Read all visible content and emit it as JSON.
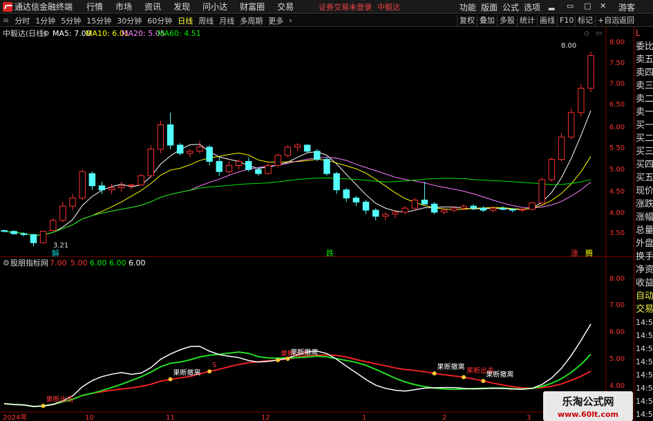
{
  "app": {
    "title": "通达信金融终端",
    "warning": "证券交易未登录",
    "stock_name_top": "中毅达",
    "guest": "游客"
  },
  "menu": [
    "行情",
    "市场",
    "资讯",
    "发现",
    "问小达",
    "财富圈",
    "交易"
  ],
  "right_menu": [
    "功能",
    "版面",
    "公式",
    "选项"
  ],
  "periods": [
    "分时",
    "1分钟",
    "5分钟",
    "15分钟",
    "30分钟",
    "60分钟",
    "日线",
    "周线",
    "月线",
    "多周期",
    "更多"
  ],
  "period_active": "日线",
  "toolbar_right": [
    "复权",
    "叠加",
    "多股",
    "统计",
    "画线",
    "F10",
    "标记",
    "+自选",
    "返回"
  ],
  "legend": {
    "name": "中毅达(日线)",
    "ma5": "MA5: 7.00",
    "ma10": "MA10: 6.01",
    "ma20": "MA20: 5.05",
    "ma60": "MA60: 4.51"
  },
  "ind_legend": {
    "name": "股朋指标网",
    "v1": "7.00",
    "v2": "5.00",
    "v3": "6.00",
    "v4": "6.00",
    "v5": "6.00"
  },
  "side_items": [
    "委比",
    "卖五",
    "卖四",
    "卖三",
    "卖二",
    "卖一",
    "买一",
    "买二",
    "买三",
    "买四",
    "买五",
    "现价",
    "涨跌",
    "涨幅",
    "总量",
    "外盘",
    "换手",
    "净资",
    "收益",
    "自动",
    "交易"
  ],
  "side_times": [
    "14:56",
    "14:56",
    "14:56",
    "14:56",
    "14:56",
    "14:56",
    "14:56",
    "14:56"
  ],
  "price_labels": [
    "8.00",
    "7.50",
    "7.00",
    "6.50",
    "6.00",
    "5.50",
    "5.00",
    "4.50",
    "4.00",
    "3.50"
  ],
  "ind_labels": [
    "8.00",
    "7.00",
    "6.00",
    "5.00",
    "4.00"
  ],
  "x_labels": [
    "2024年",
    "10",
    "11",
    "12",
    "1",
    "2",
    "3"
  ],
  "high_label": "8.00",
  "low_label": "3.21",
  "markers": {
    "jie": "解",
    "die": "跌",
    "zhang": "涨",
    "teng": "腾"
  },
  "signals": {
    "escape": "果断撤离",
    "exit": "果断出击",
    "s": "S"
  },
  "watermark": {
    "line1": "乐淘公式网",
    "line2": "www.60lt.com"
  },
  "colors": {
    "up": "#ff3232",
    "down": "#54fcfc",
    "ma5": "#ffffff",
    "ma10": "#ffff00",
    "ma20": "#ff80ff",
    "ma60": "#00e600"
  },
  "chart_data": {
    "type": "candlestick",
    "ohlc": [
      [
        3.6,
        3.62,
        3.55,
        3.58
      ],
      [
        3.58,
        3.6,
        3.5,
        3.52
      ],
      [
        3.52,
        3.55,
        3.45,
        3.5
      ],
      [
        3.5,
        3.52,
        3.21,
        3.3
      ],
      [
        3.3,
        3.6,
        3.28,
        3.58
      ],
      [
        3.6,
        3.9,
        3.58,
        3.85
      ],
      [
        3.85,
        4.3,
        3.8,
        4.2
      ],
      [
        4.2,
        4.5,
        4.1,
        4.4
      ],
      [
        4.4,
        5.1,
        4.35,
        5.05
      ],
      [
        5.0,
        5.05,
        4.6,
        4.7
      ],
      [
        4.7,
        4.8,
        4.5,
        4.6
      ],
      [
        4.6,
        4.75,
        4.5,
        4.65
      ],
      [
        4.65,
        4.8,
        4.55,
        4.7
      ],
      [
        4.7,
        4.75,
        4.6,
        4.72
      ],
      [
        4.72,
        5.0,
        4.7,
        4.95
      ],
      [
        4.95,
        5.7,
        4.9,
        5.6
      ],
      [
        5.6,
        6.3,
        5.5,
        6.2
      ],
      [
        6.2,
        6.5,
        5.6,
        5.7
      ],
      [
        5.7,
        5.75,
        5.45,
        5.5
      ],
      [
        5.5,
        5.6,
        5.4,
        5.55
      ],
      [
        5.55,
        5.8,
        5.5,
        5.65
      ],
      [
        5.65,
        5.7,
        5.2,
        5.3
      ],
      [
        5.3,
        5.4,
        4.95,
        5.05
      ],
      [
        5.05,
        5.3,
        5.0,
        5.2
      ],
      [
        5.2,
        5.35,
        5.1,
        5.3
      ],
      [
        5.3,
        5.4,
        5.05,
        5.1
      ],
      [
        5.1,
        5.15,
        4.95,
        5.0
      ],
      [
        5.0,
        5.25,
        4.98,
        5.2
      ],
      [
        5.2,
        5.5,
        5.15,
        5.45
      ],
      [
        5.45,
        5.7,
        5.4,
        5.65
      ],
      [
        5.65,
        5.75,
        5.55,
        5.7
      ],
      [
        5.7,
        5.72,
        5.5,
        5.55
      ],
      [
        5.55,
        5.6,
        5.3,
        5.35
      ],
      [
        5.35,
        5.4,
        4.95,
        5.0
      ],
      [
        5.0,
        5.05,
        4.5,
        4.6
      ],
      [
        4.6,
        4.65,
        4.3,
        4.4
      ],
      [
        4.4,
        4.45,
        4.2,
        4.3
      ],
      [
        4.3,
        4.35,
        4.0,
        4.1
      ],
      [
        4.1,
        4.15,
        3.85,
        3.95
      ],
      [
        3.95,
        4.05,
        3.85,
        4.0
      ],
      [
        4.0,
        4.1,
        3.9,
        4.05
      ],
      [
        4.05,
        4.2,
        4.0,
        4.15
      ],
      [
        4.15,
        4.4,
        4.1,
        4.35
      ],
      [
        4.35,
        4.8,
        4.3,
        4.25
      ],
      [
        4.25,
        4.3,
        4.0,
        4.05
      ],
      [
        4.05,
        4.15,
        4.0,
        4.1
      ],
      [
        4.1,
        4.2,
        4.05,
        4.15
      ],
      [
        4.15,
        4.25,
        4.1,
        4.2
      ],
      [
        4.2,
        4.25,
        4.1,
        4.15
      ],
      [
        4.15,
        4.2,
        4.05,
        4.1
      ],
      [
        4.1,
        4.2,
        4.05,
        4.15
      ],
      [
        4.15,
        4.2,
        4.1,
        4.12
      ],
      [
        4.12,
        4.15,
        4.05,
        4.1
      ],
      [
        4.1,
        4.15,
        4.05,
        4.12
      ],
      [
        4.12,
        4.3,
        4.1,
        4.28
      ],
      [
        4.28,
        4.9,
        4.25,
        4.85
      ],
      [
        4.85,
        5.4,
        4.8,
        5.35
      ],
      [
        5.35,
        6.0,
        5.3,
        5.9
      ],
      [
        5.9,
        6.6,
        5.85,
        6.5
      ],
      [
        6.5,
        7.2,
        6.4,
        7.1
      ],
      [
        7.1,
        8.0,
        7.0,
        7.9
      ]
    ],
    "ylim": [
      3.2,
      8.3
    ]
  }
}
